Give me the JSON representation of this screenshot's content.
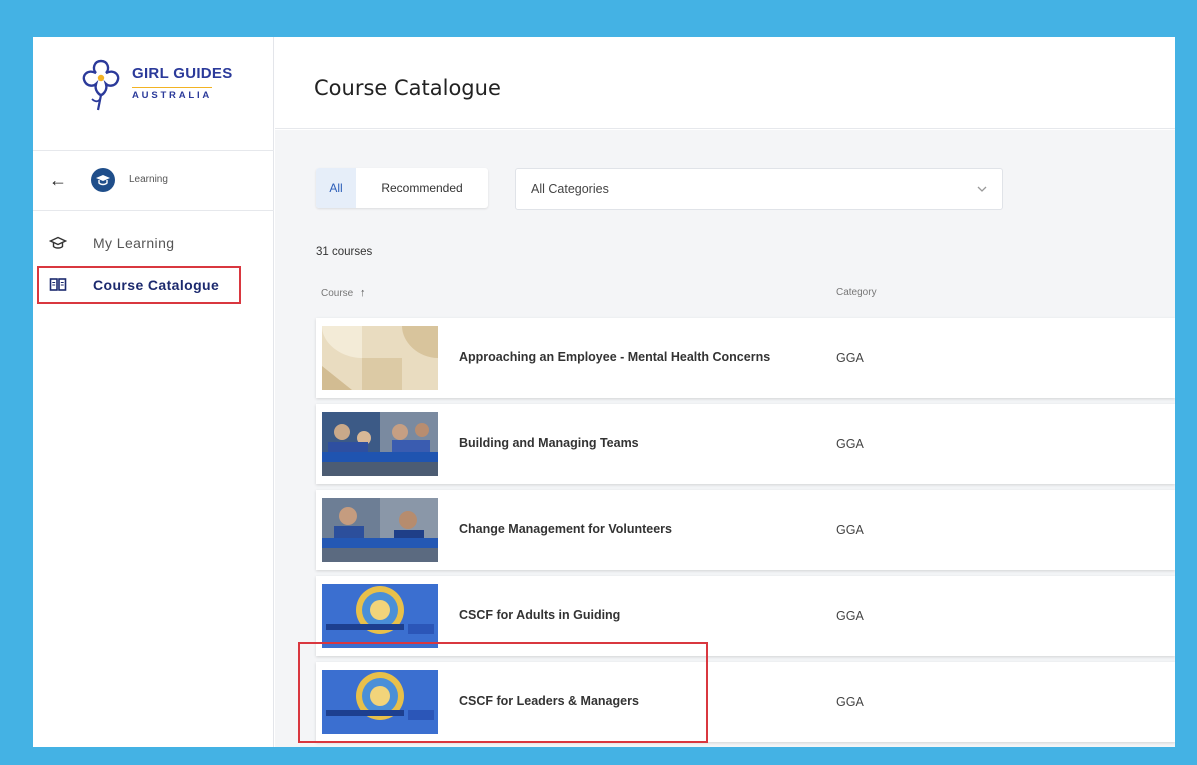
{
  "brand": {
    "line1": "GIRL GUIDES",
    "line2": "AUSTRALIA"
  },
  "sidebar": {
    "back_label": "Learning",
    "items": [
      {
        "label": "My Learning",
        "icon": "graduation-cap-icon",
        "active": false
      },
      {
        "label": "Course Catalogue",
        "icon": "book-open-icon",
        "active": true
      }
    ]
  },
  "header": {
    "title": "Course Catalogue"
  },
  "filters": {
    "tabs": [
      {
        "label": "All",
        "selected": true
      },
      {
        "label": "Recommended",
        "selected": false
      }
    ],
    "category_select": "All Categories"
  },
  "course_count": "31 courses",
  "table": {
    "columns": {
      "course": "Course",
      "category": "Category"
    },
    "sort": {
      "column": "course",
      "direction": "ascending"
    },
    "rows": [
      {
        "title": "Approaching an Employee - Mental Health Concerns",
        "category": "GGA",
        "thumb": "geometric"
      },
      {
        "title": "Building and Managing Teams",
        "category": "GGA",
        "thumb": "photo"
      },
      {
        "title": "Change Management for Volunteers",
        "category": "GGA",
        "thumb": "photo"
      },
      {
        "title": "CSCF for Adults in Guiding",
        "category": "GGA",
        "thumb": "badge"
      },
      {
        "title": "CSCF for Leaders & Managers",
        "category": "GGA",
        "thumb": "badge"
      }
    ]
  },
  "colors": {
    "frame": "#44b2e4",
    "highlight": "#d9373f",
    "brand_navy": "#2b3a9a",
    "brand_gold": "#f2b323",
    "accent_blue": "#2b5db8"
  }
}
